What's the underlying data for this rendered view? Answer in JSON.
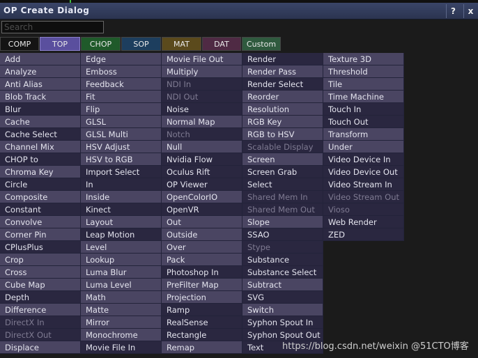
{
  "window": {
    "title": "OP Create Dialog",
    "help_label": "?",
    "close_label": "x"
  },
  "search": {
    "placeholder": "Search",
    "value": ""
  },
  "tabs": [
    {
      "label": "COMP",
      "color": "#141414",
      "active": false
    },
    {
      "label": "TOP",
      "color": "#5a4f9e",
      "active": true
    },
    {
      "label": "CHOP",
      "color": "#1f5a2a",
      "active": false
    },
    {
      "label": "SOP",
      "color": "#1d3e5e",
      "active": false
    },
    {
      "label": "MAT",
      "color": "#5b4a1c",
      "active": false
    },
    {
      "label": "DAT",
      "color": "#4f2a44",
      "active": false
    },
    {
      "label": "Custom",
      "color": "#2f5a3e",
      "active": false
    }
  ],
  "columns": [
    [
      {
        "label": "Add",
        "shade": "light"
      },
      {
        "label": "Analyze",
        "shade": "light"
      },
      {
        "label": "Anti Alias",
        "shade": "light"
      },
      {
        "label": "Blob Track",
        "shade": "light"
      },
      {
        "label": "Blur",
        "shade": "dark"
      },
      {
        "label": "Cache",
        "shade": "light"
      },
      {
        "label": "Cache Select",
        "shade": "dark"
      },
      {
        "label": "Channel Mix",
        "shade": "light"
      },
      {
        "label": "CHOP to",
        "shade": "dark"
      },
      {
        "label": "Chroma Key",
        "shade": "light"
      },
      {
        "label": "Circle",
        "shade": "dark"
      },
      {
        "label": "Composite",
        "shade": "light"
      },
      {
        "label": "Constant",
        "shade": "dark"
      },
      {
        "label": "Convolve",
        "shade": "light"
      },
      {
        "label": "Corner Pin",
        "shade": "light"
      },
      {
        "label": "CPlusPlus",
        "shade": "dark"
      },
      {
        "label": "Crop",
        "shade": "light"
      },
      {
        "label": "Cross",
        "shade": "light"
      },
      {
        "label": "Cube Map",
        "shade": "light"
      },
      {
        "label": "Depth",
        "shade": "dark"
      },
      {
        "label": "Difference",
        "shade": "light"
      },
      {
        "label": "DirectX In",
        "shade": "dark",
        "dim": true
      },
      {
        "label": "DirectX Out",
        "shade": "dark",
        "dim": true
      },
      {
        "label": "Displace",
        "shade": "light"
      }
    ],
    [
      {
        "label": "Edge",
        "shade": "light"
      },
      {
        "label": "Emboss",
        "shade": "light"
      },
      {
        "label": "Feedback",
        "shade": "light"
      },
      {
        "label": "Fit",
        "shade": "light"
      },
      {
        "label": "Flip",
        "shade": "light"
      },
      {
        "label": "GLSL",
        "shade": "light"
      },
      {
        "label": "GLSL Multi",
        "shade": "light"
      },
      {
        "label": "HSV Adjust",
        "shade": "light"
      },
      {
        "label": "HSV to RGB",
        "shade": "light"
      },
      {
        "label": "Import Select",
        "shade": "dark"
      },
      {
        "label": "In",
        "shade": "dark"
      },
      {
        "label": "Inside",
        "shade": "light"
      },
      {
        "label": "Kinect",
        "shade": "dark"
      },
      {
        "label": "Layout",
        "shade": "light"
      },
      {
        "label": "Leap Motion",
        "shade": "dark"
      },
      {
        "label": "Level",
        "shade": "light"
      },
      {
        "label": "Lookup",
        "shade": "light"
      },
      {
        "label": "Luma Blur",
        "shade": "light"
      },
      {
        "label": "Luma Level",
        "shade": "light"
      },
      {
        "label": "Math",
        "shade": "light"
      },
      {
        "label": "Matte",
        "shade": "light"
      },
      {
        "label": "Mirror",
        "shade": "light"
      },
      {
        "label": "Monochrome",
        "shade": "light"
      },
      {
        "label": "Movie File In",
        "shade": "dark"
      }
    ],
    [
      {
        "label": "Movie File Out",
        "shade": "light"
      },
      {
        "label": "Multiply",
        "shade": "light"
      },
      {
        "label": "NDI In",
        "shade": "dark",
        "dim": true
      },
      {
        "label": "NDI Out",
        "shade": "dark",
        "dim": true
      },
      {
        "label": "Noise",
        "shade": "dark"
      },
      {
        "label": "Normal Map",
        "shade": "light"
      },
      {
        "label": "Notch",
        "shade": "dark",
        "dim": true
      },
      {
        "label": "Null",
        "shade": "light"
      },
      {
        "label": "Nvidia Flow",
        "shade": "dark"
      },
      {
        "label": "Oculus Rift",
        "shade": "dark"
      },
      {
        "label": "OP Viewer",
        "shade": "dark"
      },
      {
        "label": "OpenColorIO",
        "shade": "light"
      },
      {
        "label": "OpenVR",
        "shade": "dark"
      },
      {
        "label": "Out",
        "shade": "light"
      },
      {
        "label": "Outside",
        "shade": "light"
      },
      {
        "label": "Over",
        "shade": "light"
      },
      {
        "label": "Pack",
        "shade": "light"
      },
      {
        "label": "Photoshop In",
        "shade": "dark"
      },
      {
        "label": "PreFilter Map",
        "shade": "light"
      },
      {
        "label": "Projection",
        "shade": "light"
      },
      {
        "label": "Ramp",
        "shade": "dark"
      },
      {
        "label": "RealSense",
        "shade": "dark"
      },
      {
        "label": "Rectangle",
        "shade": "dark"
      },
      {
        "label": "Remap",
        "shade": "light"
      }
    ],
    [
      {
        "label": "Render",
        "shade": "dark"
      },
      {
        "label": "Render Pass",
        "shade": "light"
      },
      {
        "label": "Render Select",
        "shade": "dark"
      },
      {
        "label": "Reorder",
        "shade": "light"
      },
      {
        "label": "Resolution",
        "shade": "light"
      },
      {
        "label": "RGB Key",
        "shade": "light"
      },
      {
        "label": "RGB to HSV",
        "shade": "light"
      },
      {
        "label": "Scalable Display",
        "shade": "dark",
        "dim": true
      },
      {
        "label": "Screen",
        "shade": "light"
      },
      {
        "label": "Screen Grab",
        "shade": "dark"
      },
      {
        "label": "Select",
        "shade": "dark"
      },
      {
        "label": "Shared Mem In",
        "shade": "dark",
        "dim": true
      },
      {
        "label": "Shared Mem Out",
        "shade": "dark",
        "dim": true
      },
      {
        "label": "Slope",
        "shade": "light"
      },
      {
        "label": "SSAO",
        "shade": "dark"
      },
      {
        "label": "Stype",
        "shade": "dark",
        "dim": true
      },
      {
        "label": "Substance",
        "shade": "dark"
      },
      {
        "label": "Substance Select",
        "shade": "dark"
      },
      {
        "label": "Subtract",
        "shade": "light"
      },
      {
        "label": "SVG",
        "shade": "dark"
      },
      {
        "label": "Switch",
        "shade": "light"
      },
      {
        "label": "Syphon Spout In",
        "shade": "dark"
      },
      {
        "label": "Syphon Spout Out",
        "shade": "dark"
      },
      {
        "label": "Text",
        "shade": "dark"
      }
    ],
    [
      {
        "label": "Texture 3D",
        "shade": "light"
      },
      {
        "label": "Threshold",
        "shade": "light"
      },
      {
        "label": "Tile",
        "shade": "light"
      },
      {
        "label": "Time Machine",
        "shade": "light"
      },
      {
        "label": "Touch In",
        "shade": "dark"
      },
      {
        "label": "Touch Out",
        "shade": "dark"
      },
      {
        "label": "Transform",
        "shade": "light"
      },
      {
        "label": "Under",
        "shade": "light"
      },
      {
        "label": "Video Device In",
        "shade": "dark"
      },
      {
        "label": "Video Device Out",
        "shade": "dark"
      },
      {
        "label": "Video Stream In",
        "shade": "dark"
      },
      {
        "label": "Video Stream Out",
        "shade": "dark",
        "dim": true
      },
      {
        "label": "Vioso",
        "shade": "dark",
        "dim": true
      },
      {
        "label": "Web Render",
        "shade": "dark"
      },
      {
        "label": "ZED",
        "shade": "dark"
      }
    ]
  ],
  "watermark": "https://blog.csdn.net/weixin @51CTO博客"
}
